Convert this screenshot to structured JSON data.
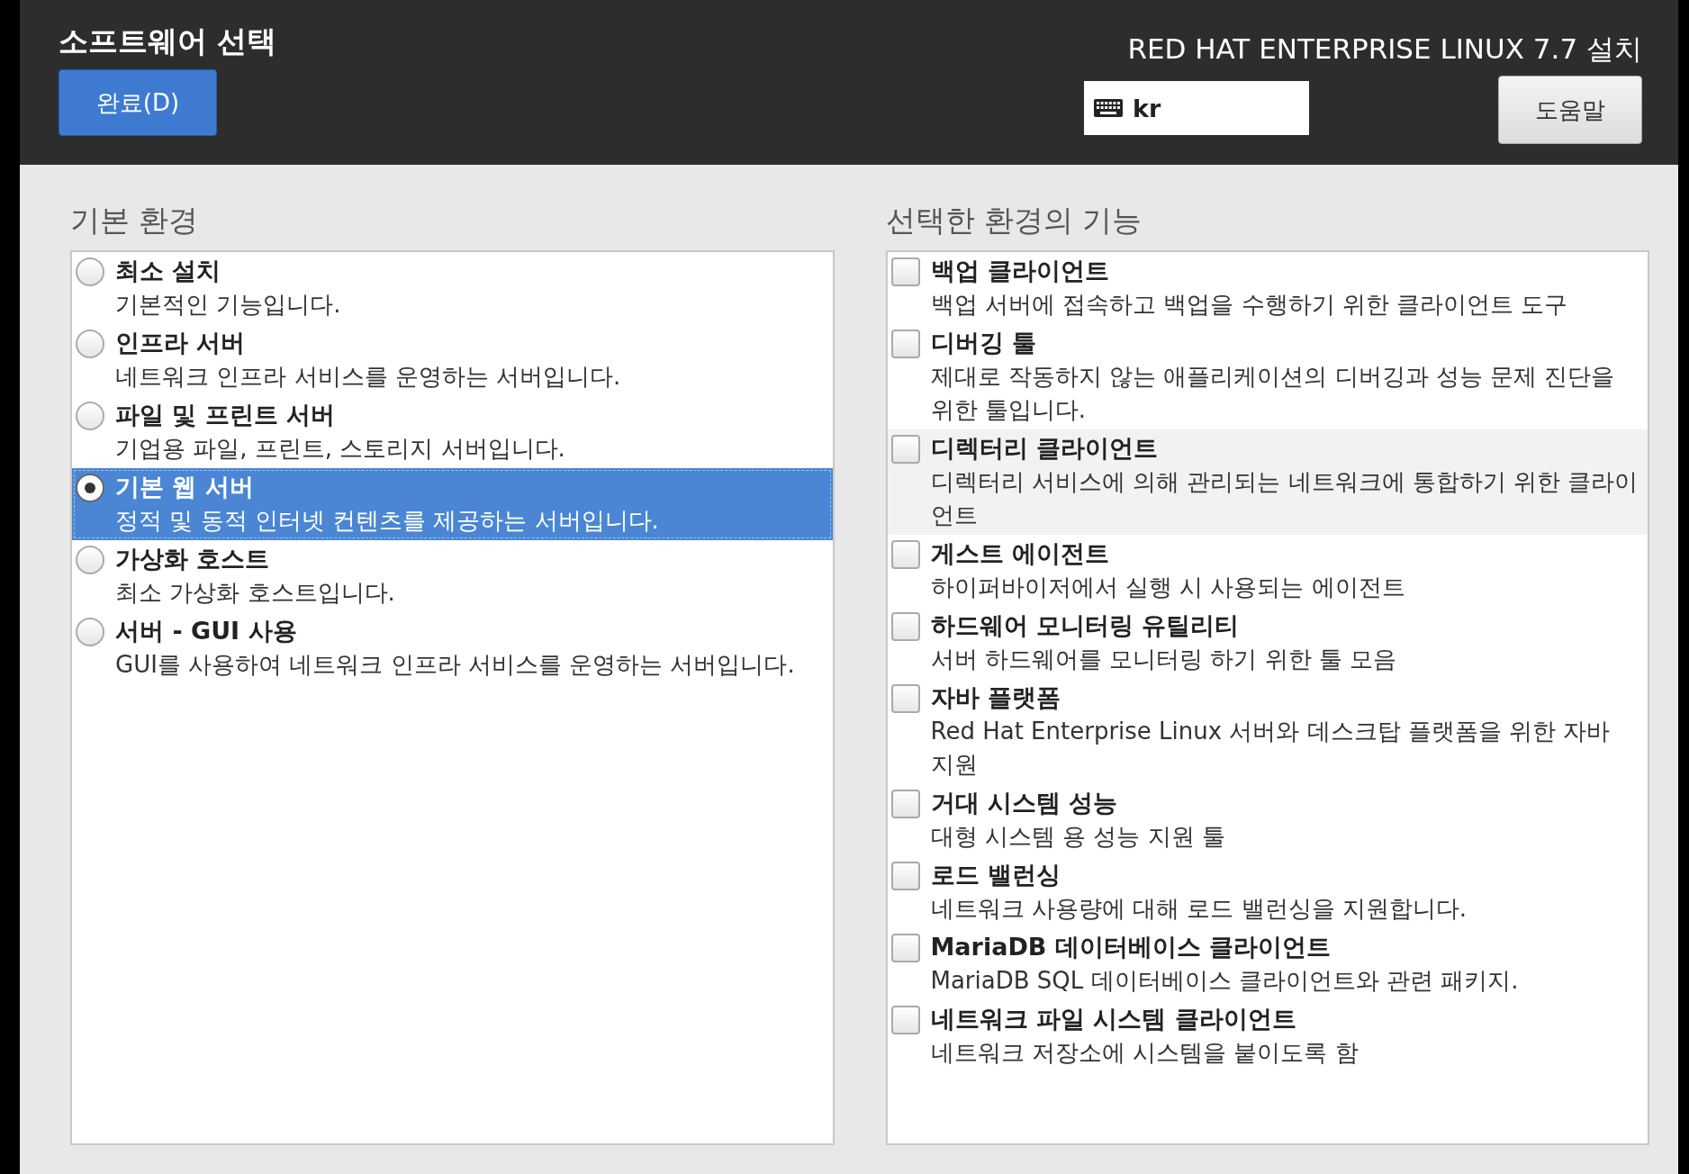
{
  "header": {
    "title": "소프트웨어 선택",
    "done_button": "완료(D)",
    "product": "RED HAT ENTERPRISE LINUX 7.7 설치",
    "keyboard_layout": "kr",
    "help_button": "도움말"
  },
  "environments": {
    "heading": "기본 환경",
    "items": [
      {
        "name": "최소 설치",
        "description": "기본적인 기능입니다.",
        "selected": false
      },
      {
        "name": "인프라 서버",
        "description": "네트워크 인프라 서비스를 운영하는 서버입니다.",
        "selected": false
      },
      {
        "name": "파일 및 프린트 서버",
        "description": "기업용 파일, 프린트, 스토리지 서버입니다.",
        "selected": false
      },
      {
        "name": "기본 웹 서버",
        "description": "정적 및 동적 인터넷 컨텐츠를 제공하는 서버입니다.",
        "selected": true
      },
      {
        "name": "가상화 호스트",
        "description": "최소 가상화 호스트입니다.",
        "selected": false
      },
      {
        "name": "서버 - GUI 사용",
        "description": "GUI를 사용하여 네트워크 인프라 서비스를 운영하는 서버입니다.",
        "selected": false
      }
    ]
  },
  "addons": {
    "heading": "선택한 환경의 기능",
    "items": [
      {
        "name": "백업 클라이언트",
        "description": "백업 서버에 접속하고 백업을 수행하기 위한 클라이언트 도구",
        "checked": false,
        "highlighted": false
      },
      {
        "name": "디버깅 툴",
        "description": "제대로 작동하지 않는 애플리케이션의 디버깅과 성능 문제 진단을 위한 툴입니다.",
        "checked": false,
        "highlighted": false
      },
      {
        "name": "디렉터리 클라이언트",
        "description": "디렉터리 서비스에 의해 관리되는 네트워크에 통합하기 위한 클라이언트",
        "checked": false,
        "highlighted": true
      },
      {
        "name": "게스트 에이전트",
        "description": "하이퍼바이저에서 실행 시 사용되는 에이전트",
        "checked": false,
        "highlighted": false
      },
      {
        "name": "하드웨어 모니터링 유틸리티",
        "description": "서버 하드웨어를 모니터링 하기 위한 툴 모음",
        "checked": false,
        "highlighted": false
      },
      {
        "name": "자바 플랫폼",
        "description": "Red Hat Enterprise Linux 서버와 데스크탑 플랫폼을 위한 자바 지원",
        "checked": false,
        "highlighted": false
      },
      {
        "name": "거대 시스템 성능",
        "description": "대형 시스템 용 성능 지원 툴",
        "checked": false,
        "highlighted": false
      },
      {
        "name": "로드 밸런싱",
        "description": "네트워크 사용량에 대해 로드 밸런싱을 지원합니다.",
        "checked": false,
        "highlighted": false
      },
      {
        "name": "MariaDB 데이터베이스 클라이언트",
        "description": "MariaDB SQL 데이터베이스 클라이언트와 관련 패키지.",
        "checked": false,
        "highlighted": false
      },
      {
        "name": "네트워크 파일 시스템 클라이언트",
        "description": "네트워크 저장소에 시스템을 붙이도록 함",
        "checked": false,
        "highlighted": false
      }
    ]
  }
}
